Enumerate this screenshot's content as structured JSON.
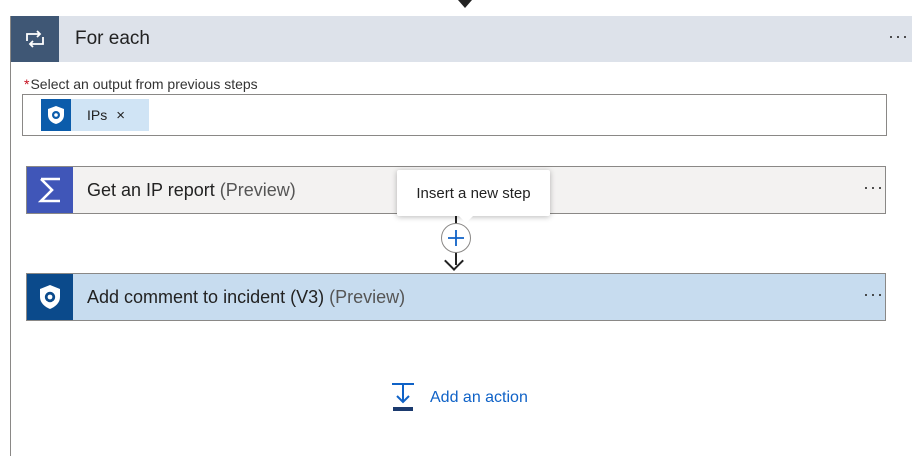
{
  "foreach": {
    "title": "For each",
    "more": "···",
    "icon": "loop-icon"
  },
  "select_output": {
    "label": "Select an output from previous steps",
    "required_marker": "*",
    "token": {
      "label": "IPs",
      "remove": "×",
      "icon": "sentinel-shield-icon"
    }
  },
  "actions": [
    {
      "title": "Get an IP report",
      "preview": "(Preview)",
      "more": "···",
      "icon": "sigma-icon"
    },
    {
      "title": "Add comment to incident (V3)",
      "preview": "(Preview)",
      "more": "···",
      "icon": "sentinel-shield-icon"
    }
  ],
  "insert_step": {
    "tooltip": "Insert a new step",
    "icon": "plus-icon"
  },
  "add_action": {
    "label": "Add an action",
    "icon": "add-action-icon"
  },
  "colors": {
    "foreach_header": "#dde2ea",
    "foreach_icon_bg": "#3f5775",
    "token_bg": "#d0e4f5",
    "sentinel_blue": "#0b4a8b",
    "sigma_bg": "#4056b8",
    "selected_action_bg": "#c7dcef",
    "link_blue": "#0f62c7"
  }
}
